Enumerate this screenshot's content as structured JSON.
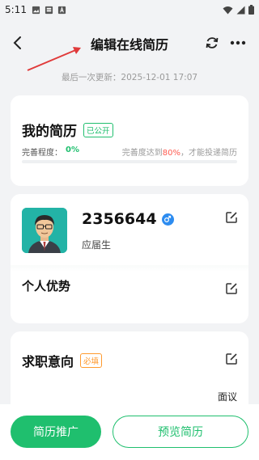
{
  "status_bar": {
    "time": "5:11",
    "icons": [
      "gallery-icon",
      "notification-icon",
      "font-icon",
      "wifi-icon",
      "signal-icon",
      "battery-icon"
    ]
  },
  "header": {
    "title": "编辑在线简历",
    "back_icon": "back-chevron-icon",
    "refresh_icon": "refresh-icon",
    "more_icon": "more-icon"
  },
  "last_updated": "最后一次更新：2025-12-01 17:07",
  "resume": {
    "title": "我的简历",
    "visibility_tag": "已公开",
    "progress_label": "完善程度：",
    "progress_value": "0%",
    "progress_fraction": 0,
    "tip_prefix": "完善度达到",
    "tip_percent": "80%",
    "tip_suffix": "，才能投递简历"
  },
  "profile": {
    "name": "2356644",
    "gender_icon": "male-icon",
    "status": "应届生",
    "advantage_title": "个人优势"
  },
  "job_intent": {
    "title": "求职意向",
    "required_tag": "必填",
    "salary": "面议"
  },
  "bottom": {
    "promote_label": "简历推广",
    "preview_label": "预览简历"
  },
  "colors": {
    "accent": "#1fbf6e",
    "warning": "#ff9a2e",
    "highlight": "#ff5a4f",
    "annotation": "#e03a3a"
  }
}
